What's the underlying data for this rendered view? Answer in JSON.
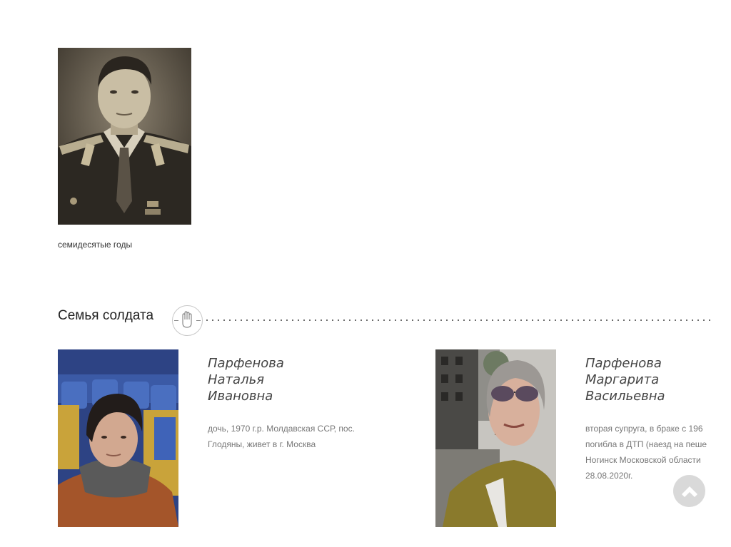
{
  "top_photo": {
    "alt": "портрет",
    "caption": "семидесятые годы"
  },
  "section": {
    "title": "Семья солдата",
    "icon": "hand-icon"
  },
  "members": [
    {
      "name_lines": [
        "Парфенова",
        "Наталья",
        "Ивановна"
      ],
      "desc_lines": [
        "дочь, 1970 г.р. Молдавская ССР, пос.",
        "Глодяны, живет в г. Москва"
      ]
    },
    {
      "name_lines": [
        "Парфенова",
        "Маргарита",
        "Васильевна"
      ],
      "desc_lines": [
        "вторая супруга, в браке с 196",
        "погибла в ДТП (наезд на пеше",
        "Ногинск Московской области",
        "28.08.2020г."
      ]
    }
  ],
  "scroll_top": {
    "icon": "chevron-up-icon"
  },
  "colors": {
    "background": "#ffffff",
    "name_text": "#444444",
    "desc_text": "#777777",
    "button_bg": "#d9d9d9"
  }
}
